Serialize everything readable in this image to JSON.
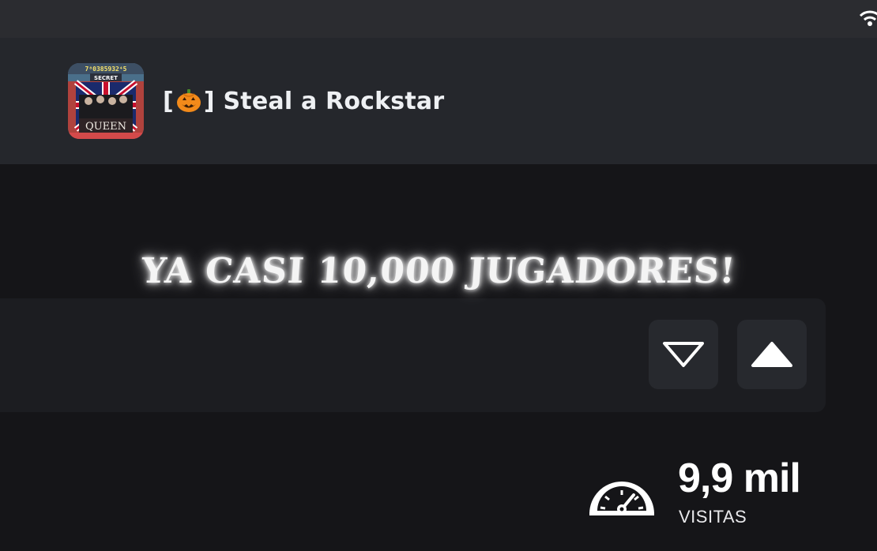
{
  "game": {
    "title_prefix": "[",
    "title_suffix": "] Steal a Rockstar",
    "thumbnail": {
      "top_text": "7⁸0385932⁴5",
      "badge": "SECRET",
      "label": "QUEEN"
    }
  },
  "banner": {
    "text": "YA CASI 10,000 JUGADORES!"
  },
  "votes": {
    "down_icon": "thumbs-down-outline-icon",
    "up_icon": "thumbs-up-filled-icon"
  },
  "stats": {
    "visits_value": "9,9 mil",
    "visits_label": "VISITAS",
    "icon": "speedometer-icon"
  },
  "colors": {
    "background": "#151518",
    "header": "#25272c",
    "panel": "#1c1d21",
    "button": "#27292e",
    "text": "#ffffff"
  }
}
